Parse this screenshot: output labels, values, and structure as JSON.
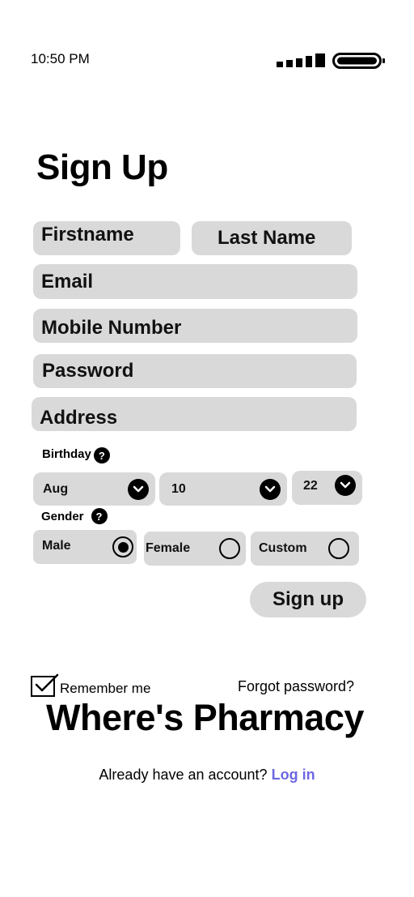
{
  "status_bar": {
    "time": "10:50 PM"
  },
  "title": "Sign Up",
  "fields": {
    "firstname": "Firstname",
    "lastname": "Last Name",
    "email": "Email",
    "mobile": "Mobile Number",
    "password": "Password",
    "address": "Address"
  },
  "birthday": {
    "label": "Birthday",
    "month": "Aug",
    "day": "10",
    "year": "22"
  },
  "gender": {
    "label": "Gender",
    "options": [
      "Male",
      "Female",
      "Custom"
    ],
    "selected": "Male"
  },
  "help_glyph": "?",
  "signup_button": "Sign up",
  "remember_me": "Remember me",
  "forgot_password": "Forgot password?",
  "brand": "Where's Pharmacy",
  "footer": {
    "prompt": "Already have an account?",
    "login": "Log in"
  },
  "colors": {
    "field_bg": "#d9d9d9",
    "link": "#6d67e4"
  }
}
